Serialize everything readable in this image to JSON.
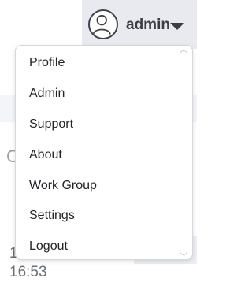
{
  "header": {
    "username": "admin",
    "avatar_icon": "user-avatar-icon",
    "caret_icon": "caret-down-icon"
  },
  "background": {
    "partial_letter": "C",
    "partial_text_line1": "1",
    "partial_text_line2": "16:53"
  },
  "menu": {
    "items": [
      {
        "label": "Profile"
      },
      {
        "label": "Admin"
      },
      {
        "label": "Support"
      },
      {
        "label": "About"
      },
      {
        "label": "Work Group"
      },
      {
        "label": "Settings"
      },
      {
        "label": "Logout"
      }
    ]
  },
  "colors": {
    "header_bg": "#e8eaef",
    "text": "#222427",
    "border": "#d6d8dc"
  }
}
